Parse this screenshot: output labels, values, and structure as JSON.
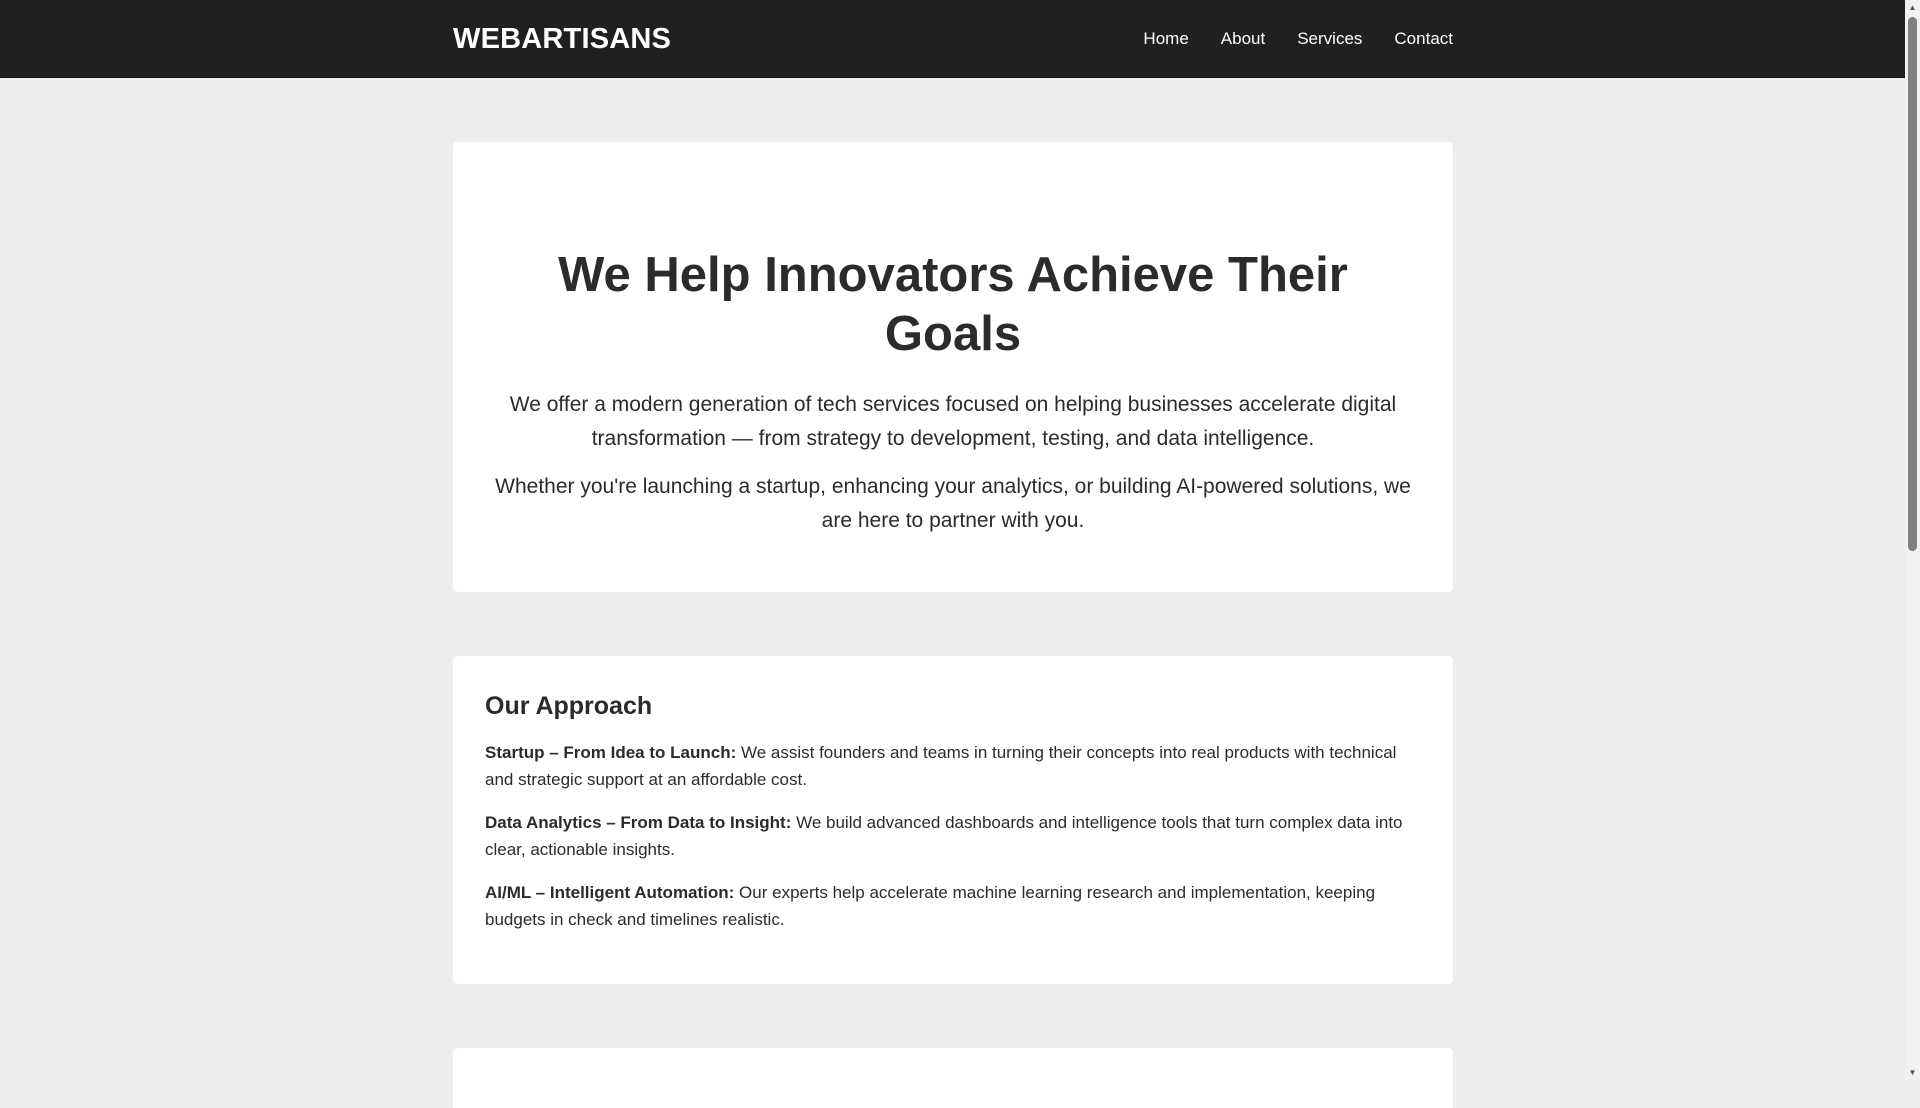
{
  "header": {
    "logo": "WEBARTISANS",
    "nav": [
      {
        "label": "Home"
      },
      {
        "label": "About"
      },
      {
        "label": "Services"
      },
      {
        "label": "Contact"
      }
    ]
  },
  "hero": {
    "title": "We Help Innovators Achieve Their Goals",
    "paragraph1": "We offer a modern generation of tech services focused on helping businesses accelerate digital transformation — from strategy to development, testing, and data intelligence.",
    "paragraph2": "Whether you're launching a startup, enhancing your analytics, or building AI-powered solutions, we are here to partner with you."
  },
  "approach": {
    "title": "Our Approach",
    "items": [
      {
        "heading": "Startup – From Idea to Launch:",
        "text": " We assist founders and teams in turning their concepts into real products with technical and strategic support at an affordable cost."
      },
      {
        "heading": "Data Analytics – From Data to Insight:",
        "text": " We build advanced dashboards and intelligence tools that turn complex data into clear, actionable insights."
      },
      {
        "heading": "AI/ML – Intelligent Automation:",
        "text": " Our experts help accelerate machine learning research and implementation, keeping budgets in check and timelines realistic."
      }
    ]
  },
  "icons": {
    "scroll_up": "scroll-up-arrow-icon",
    "scroll_down": "scroll-down-arrow-icon"
  },
  "colors": {
    "header_bg": "#202020",
    "page_bg": "#ededed",
    "card_bg": "#ffffff",
    "text": "#2b2b2b"
  }
}
